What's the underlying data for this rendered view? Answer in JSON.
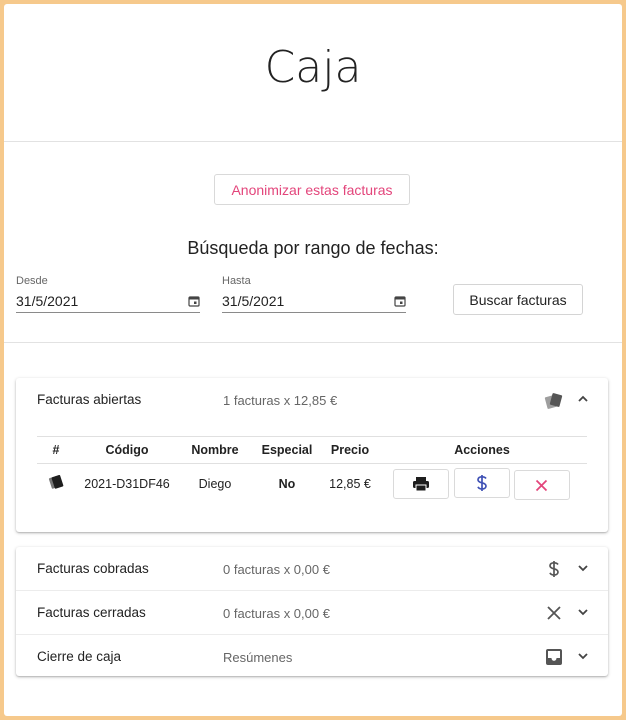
{
  "page": {
    "title": "Caja",
    "anonymize_label": "Anonimizar estas facturas",
    "range_title": "Búsqueda por rango de fechas:",
    "from_label": "Desde",
    "from_value": "31/5/2021",
    "to_label": "Hasta",
    "to_value": "31/5/2021",
    "search_label": "Buscar facturas"
  },
  "open": {
    "name": "Facturas abiertas",
    "summary": "1 facturas x 12,85 €",
    "columns": [
      "#",
      "Código",
      "Nombre",
      "Especial",
      "Precio",
      "Acciones"
    ],
    "rows": [
      {
        "code": "2021-D31DF46",
        "name": "Diego",
        "special": "No",
        "price": "12,85 €"
      }
    ]
  },
  "sections": [
    {
      "name": "Facturas cobradas",
      "summary": "0 facturas x 0,00 €",
      "icon": "dollar-icon"
    },
    {
      "name": "Facturas cerradas",
      "summary": "0 facturas x 0,00 €",
      "icon": "close-icon"
    },
    {
      "name": "Cierre de caja",
      "summary": "Resúmenes",
      "icon": "inbox-icon"
    }
  ],
  "colors": {
    "accent": "#e3457b",
    "dollar": "#3f51b5",
    "delete": "#e3457b",
    "background": "#f6c98c"
  }
}
